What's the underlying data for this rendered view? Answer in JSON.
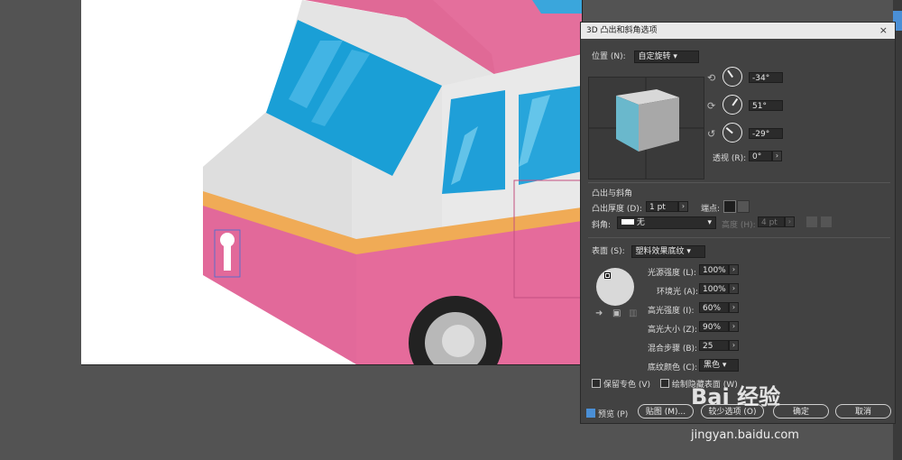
{
  "dialog": {
    "title": "3D 凸出和斜角选项",
    "close_symbol": "×",
    "position_label": "位置 (N):",
    "position_value": "自定旋转",
    "rotation_x": "-34°",
    "rotation_y": "51°",
    "rotation_z": "-29°",
    "perspective_label": "透视 (R):",
    "perspective_value": "0°",
    "extrude_section": "凸出与斜角",
    "extrude_depth_label": "凸出厚度 (D):",
    "extrude_depth_value": "1 pt",
    "cap_label": "端点:",
    "bevel_label": "斜角:",
    "bevel_value": "无",
    "height_label": "高度 (H):",
    "height_value": "4 pt",
    "surface_label": "表面 (S):",
    "surface_value": "塑料效果底纹",
    "light_intensity_label": "光源强度 (L):",
    "light_intensity_value": "100%",
    "ambient_label": "环境光 (A):",
    "ambient_value": "100%",
    "highlight_intensity_label": "高光强度 (I):",
    "highlight_intensity_value": "60%",
    "highlight_size_label": "高光大小 (Z):",
    "highlight_size_value": "90%",
    "blend_steps_label": "混合步骤 (B):",
    "blend_steps_value": "25",
    "shading_color_label": "底纹颜色 (C):",
    "shading_color_value": "黑色",
    "preserve_spot_label": "保留专色 (V)",
    "draw_hidden_label": "绘制隐藏表面 (W)",
    "preview_label": "预览 (P)",
    "map_button": "贴图 (M)...",
    "fewer_options_button": "较少选项 (O)",
    "ok_button": "确定",
    "cancel_button": "取消"
  },
  "watermark": {
    "logo_text": "Bai 经验",
    "url": "jingyan.baidu.com"
  },
  "colors": {
    "truck_pink": "#e56b9b",
    "truck_stripe": "#f0ab56",
    "truck_white": "#e6e6e6",
    "window_blue": "#2aa3d6",
    "dialog_bg": "#424242",
    "accent_blue": "#4a8fd6"
  }
}
